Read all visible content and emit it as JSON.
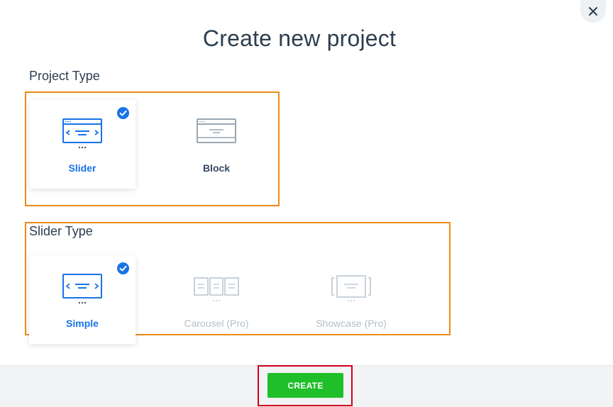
{
  "dialog": {
    "title": "Create new project",
    "close_icon": "close-icon"
  },
  "project_type": {
    "label": "Project Type",
    "options": [
      {
        "label": "Slider",
        "icon": "slider-icon",
        "selected": true
      },
      {
        "label": "Block",
        "icon": "block-icon",
        "selected": false
      }
    ]
  },
  "slider_type": {
    "label": "Slider Type",
    "options": [
      {
        "label": "Simple",
        "icon": "simple-slider-icon",
        "selected": true,
        "disabled": false
      },
      {
        "label": "Carousel (Pro)",
        "icon": "carousel-icon",
        "selected": false,
        "disabled": true
      },
      {
        "label": "Showcase (Pro)",
        "icon": "showcase-icon",
        "selected": false,
        "disabled": true
      }
    ]
  },
  "footer": {
    "create_label": "CREATE"
  },
  "colors": {
    "accent": "#1873e8",
    "create_button": "#1fbf2a",
    "highlight_orange": "#ef8a17",
    "highlight_red": "#d0021b",
    "disabled": "#b4bec8"
  }
}
